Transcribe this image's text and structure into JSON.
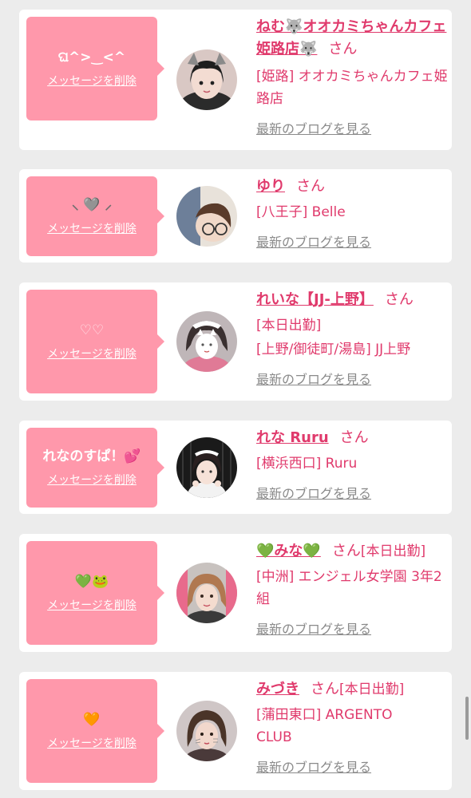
{
  "delete_label": "メッセージを削除",
  "san_label": "さん",
  "blog_label": "最新のブログを見る",
  "colors": {
    "bubble": "#ff98ab",
    "accent": "#e03a6c",
    "link_gray": "#8a8a8a",
    "background": "#ececec"
  },
  "cards": [
    {
      "message": "ଘ^>‿<^",
      "name": "ねむ🐺オオカミちゃんカフェ姫路店🐺",
      "shop": "[姫路] オオカミちゃんカフェ姫路店",
      "attendance": ""
    },
    {
      "message": "⸜ 🩶 ⸝",
      "name": "ゆり",
      "shop": "[八王子] Belle",
      "attendance": ""
    },
    {
      "message": "♡♡",
      "name": "れいな【JJ-上野】",
      "shop": "[本日出勤]",
      "shop2": "[上野/御徒町/湯島] JJ上野",
      "attendance": ""
    },
    {
      "message": "れなのすぱ！💕",
      "name": "れな Ruru",
      "shop": "[横浜西口] Ruru",
      "attendance": ""
    },
    {
      "message": "💚🐸",
      "name": "💚みな💚",
      "shop": "[中洲] エンジェル女学園 3年2組",
      "attendance": "[本日出勤]"
    },
    {
      "message": "🧡",
      "name": "みづき",
      "shop": "[蒲田東口] ARGENTO CLUB",
      "attendance": "[本日出勤]"
    }
  ]
}
